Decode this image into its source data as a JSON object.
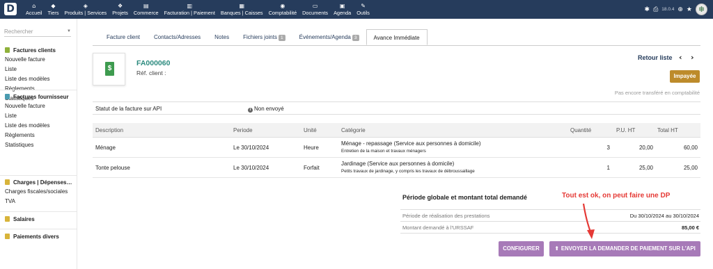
{
  "app": {
    "logo_letter": "D"
  },
  "topmenu": [
    {
      "icon": "⌂",
      "icon_name": "home-icon",
      "label": "Accueil"
    },
    {
      "icon": "◆",
      "icon_name": "building-icon",
      "label": "Tiers"
    },
    {
      "icon": "◈",
      "icon_name": "cube-icon",
      "label": "Produits | Services"
    },
    {
      "icon": "❖",
      "icon_name": "projects-icon",
      "label": "Projets"
    },
    {
      "icon": "▤",
      "icon_name": "commerce-icon",
      "label": "Commerce"
    },
    {
      "icon": "▥",
      "icon_name": "billing-icon",
      "label": "Facturation | Paiement"
    },
    {
      "icon": "▦",
      "icon_name": "bank-icon",
      "label": "Banques | Caisses"
    },
    {
      "icon": "◉",
      "icon_name": "accounting-icon",
      "label": "Comptabilité"
    },
    {
      "icon": "▭",
      "icon_name": "documents-icon",
      "label": "Documents"
    },
    {
      "icon": "▣",
      "icon_name": "calendar-icon",
      "label": "Agenda"
    },
    {
      "icon": "✎",
      "icon_name": "tools-icon",
      "label": "Outils"
    }
  ],
  "topright": {
    "version": "18.0.4"
  },
  "sidebar": {
    "search_placeholder": "Rechercher",
    "groups": [
      {
        "title": "Factures clients",
        "color": "#8fb13a",
        "items": [
          "Nouvelle facture",
          "Liste",
          "Liste des modèles",
          "Règlements",
          "Statistiques"
        ]
      },
      {
        "title": "Factures fournisseur",
        "color": "#4a9bb0",
        "items": [
          "Nouvelle facture",
          "Liste",
          "Liste des modèles",
          "Règlements",
          "Statistiques"
        ]
      },
      {
        "title": "Charges | Dépenses…",
        "color": "#d8b43a",
        "items": [
          "Charges fiscales/sociales",
          "TVA"
        ]
      },
      {
        "title": "Salaires",
        "color": "#d8b43a",
        "items": []
      },
      {
        "title": "Paiements divers",
        "color": "#d8b43a",
        "items": []
      }
    ]
  },
  "tabs": [
    {
      "label": "Facture client",
      "badge": ""
    },
    {
      "label": "Contacts/Adresses",
      "badge": ""
    },
    {
      "label": "Notes",
      "badge": ""
    },
    {
      "label": "Fichiers joints",
      "badge": "1"
    },
    {
      "label": "Événements/Agenda",
      "badge": "3"
    },
    {
      "label": "Avance Immédiate",
      "badge": ""
    }
  ],
  "invoice": {
    "ref": "FA000060",
    "ref_client_label": "Réf. client :",
    "back_link": "Retour liste",
    "status": "Impayée",
    "status_color": "#bd8b2b",
    "transfer_note": "Pas encore transféré en comptabilité"
  },
  "api": {
    "label": "Statut de la facture sur API",
    "value": "Non envoyé"
  },
  "lines": {
    "headers": {
      "description": "Description",
      "periode": "Periode",
      "unite": "Unité",
      "categorie": "Catégorie",
      "quantite": "Quantité",
      "pu": "P.U. HT",
      "total": "Total HT"
    },
    "rows": [
      {
        "description": "Ménage",
        "periode": "Le 30/10/2024",
        "unite": "Heure",
        "categorie": "Ménage - repassage (Service aux personnes à domicile)",
        "categorie_detail": "Entretien de la maison et travaux ménagers",
        "quantite": "3",
        "pu": "20,00",
        "total": "60,00"
      },
      {
        "description": "Tonte pelouse",
        "periode": "Le 30/10/2024",
        "unite": "Forfait",
        "categorie": "Jardinage (Service aux personnes à domicile)",
        "categorie_detail": "Petits travaux de jardinage, y compris les travaux de débroussaillage",
        "quantite": "1",
        "pu": "25,00",
        "total": "25,00"
      }
    ]
  },
  "summary": {
    "title": "Période globale et montant total demandé",
    "annotation": "Tout est ok, on peut faire une DP",
    "annotation_color": "#e53935",
    "rows": [
      {
        "label": "Période de réalisation des prestations",
        "value": "Du 30/10/2024 au 30/10/2024"
      },
      {
        "label": "Montant demandé à l'URSSAF",
        "value": "85,00 €"
      }
    ]
  },
  "buttons": {
    "configure": "CONFIGURER",
    "send": "ENVOYER LA DEMANDER DE PAIEMENT SUR L'API"
  },
  "colors": {
    "navbar": "#263c5c",
    "button": "#a77ab8",
    "ref": "#2b8a7e"
  }
}
